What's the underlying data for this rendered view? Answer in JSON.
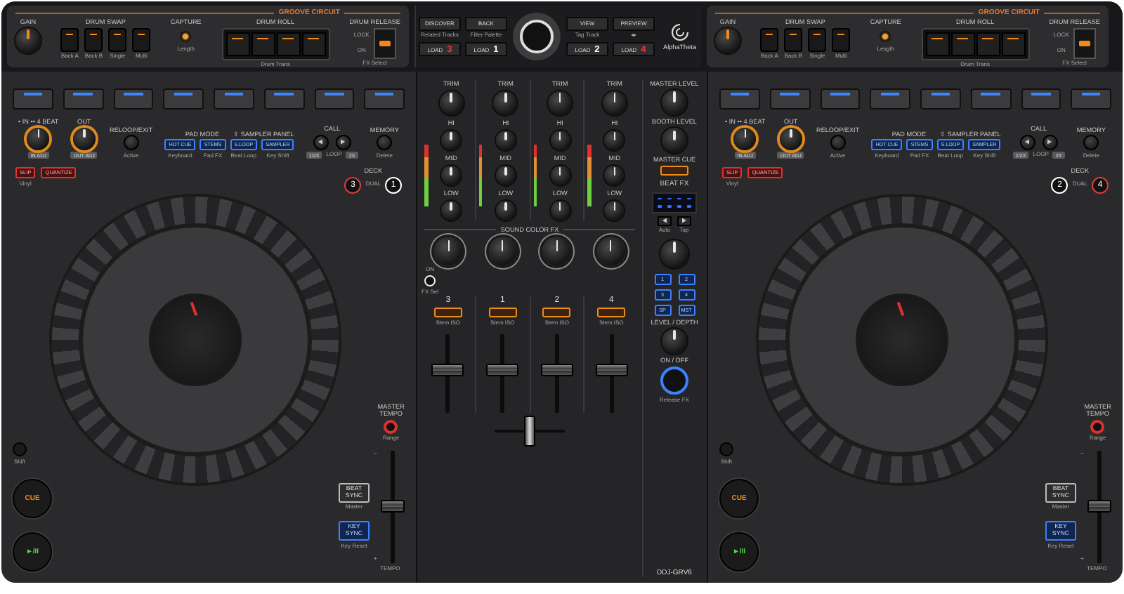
{
  "groove_circuits": [
    {
      "title": "GROOVE CIRCUIT",
      "gain": "GAIN",
      "drum_swap": {
        "label": "DRUM SWAP",
        "buttons": [
          "Back A",
          "Back B",
          "Single",
          "Multi"
        ]
      },
      "capture": {
        "label": "CAPTURE",
        "sub": "Length"
      },
      "drum_roll": {
        "label": "DRUM ROLL",
        "sub": "Drum Trans"
      },
      "drum_release": {
        "label": "DRUM RELEASE",
        "lock": "LOCK",
        "on": "ON",
        "sub": "FX Select"
      }
    },
    {
      "title": "GROOVE CIRCUIT",
      "gain": "GAIN",
      "drum_swap": {
        "label": "DRUM SWAP",
        "buttons": [
          "Back A",
          "Back B",
          "Single",
          "Multi"
        ]
      },
      "capture": {
        "label": "CAPTURE",
        "sub": "Length"
      },
      "drum_roll": {
        "label": "DRUM ROLL",
        "sub": "Drum Trans"
      },
      "drum_release": {
        "label": "DRUM RELEASE",
        "lock": "LOCK",
        "on": "ON",
        "sub": "FX Select"
      }
    }
  ],
  "browser": {
    "left": [
      {
        "label": "DISCOVER",
        "sub": "Related Tracks"
      },
      {
        "label": "BACK",
        "sub": "Filter Palette"
      }
    ],
    "right": [
      {
        "label": "VIEW",
        "sub": "Tag Track"
      },
      {
        "label": "PREVIEW",
        "sub": "◂▸"
      }
    ],
    "loads_left": [
      {
        "label": "LOAD",
        "deck": "3",
        "color": "#e03a3a"
      },
      {
        "label": "LOAD",
        "deck": "1",
        "color": "#ffffff"
      }
    ],
    "loads_right": [
      {
        "label": "LOAD",
        "deck": "2",
        "color": "#ffffff"
      },
      {
        "label": "LOAD",
        "deck": "4",
        "color": "#e03a3a"
      }
    ],
    "logo": "AlphaTheta"
  },
  "decks": [
    {
      "loop_in": {
        "label": "• IN  •• 4 BEAT",
        "sub": "IN ADJ"
      },
      "loop_out": {
        "label": "OUT",
        "sub": "OUT ADJ"
      },
      "reloop": {
        "label": "RELOOP/EXIT",
        "sub": "Active"
      },
      "pad_mode": {
        "label": "PAD MODE",
        "shift_label": "⇧ SAMPLER PANEL",
        "modes": [
          {
            "label": "HOT CUE",
            "sub": "Keyboard"
          },
          {
            "label": "STEMS",
            "sub": "Pad FX"
          },
          {
            "label": "S.LOOP",
            "sub": "Beat Loop"
          },
          {
            "label": "SAMPLER",
            "sub": "Key Shift"
          }
        ]
      },
      "call": {
        "label": "CALL",
        "loop": "LOOP",
        "left": "1/2X",
        "right": "2X"
      },
      "memory": {
        "label": "MEMORY",
        "sub": "Delete"
      },
      "slip": {
        "label": "SLIP",
        "sub": "Vinyl"
      },
      "quantize": "QUANTIZE",
      "deck_select": {
        "label": "DECK",
        "dual": "DUAL",
        "decks": [
          {
            "number": "3",
            "color": "#e03a3a"
          },
          {
            "number": "1",
            "color": "#ffffff"
          }
        ]
      },
      "shift": "Shift",
      "cue": "CUE",
      "play": "►/II",
      "master_tempo": {
        "label": "MASTER TEMPO",
        "sub": "Range"
      },
      "beat_sync": {
        "label": "BEAT SYNC",
        "sub": "Master"
      },
      "key_sync": {
        "label": "KEY SYNC",
        "sub": "Key Reset"
      },
      "tempo": {
        "label": "TEMPO",
        "minus": "−",
        "plus": "+",
        "level": 0.5
      }
    },
    {
      "loop_in": {
        "label": "• IN  •• 4 BEAT",
        "sub": "IN ADJ"
      },
      "loop_out": {
        "label": "OUT",
        "sub": "OUT ADJ"
      },
      "reloop": {
        "label": "RELOOP/EXIT",
        "sub": "Active"
      },
      "pad_mode": {
        "label": "PAD MODE",
        "shift_label": "⇧ SAMPLER PANEL",
        "modes": [
          {
            "label": "HOT CUE",
            "sub": "Keyboard"
          },
          {
            "label": "STEMS",
            "sub": "Pad FX"
          },
          {
            "label": "S.LOOP",
            "sub": "Beat Loop"
          },
          {
            "label": "SAMPLER",
            "sub": "Key Shift"
          }
        ]
      },
      "call": {
        "label": "CALL",
        "loop": "LOOP",
        "left": "1/2X",
        "right": "2X"
      },
      "memory": {
        "label": "MEMORY",
        "sub": "Delete"
      },
      "slip": {
        "label": "SLIP",
        "sub": "Vinyl"
      },
      "quantize": "QUANTIZE",
      "deck_select": {
        "label": "DECK",
        "dual": "DUAL",
        "decks": [
          {
            "number": "2",
            "color": "#ffffff"
          },
          {
            "number": "4",
            "color": "#e03a3a"
          }
        ]
      },
      "shift": "Shift",
      "cue": "CUE",
      "play": "►/II",
      "master_tempo": {
        "label": "MASTER TEMPO",
        "sub": "Range"
      },
      "beat_sync": {
        "label": "BEAT SYNC",
        "sub": "Master"
      },
      "key_sync": {
        "label": "KEY SYNC",
        "sub": "Key Reset"
      },
      "tempo": {
        "label": "TEMPO",
        "minus": "−",
        "plus": "+",
        "level": 0.5
      }
    }
  ],
  "mixer": {
    "channels": [
      {
        "number": "3",
        "trim": "TRIM",
        "hi": "HI",
        "mid": "MID",
        "low": "LOW",
        "cue": "Stem ISO",
        "level": 0.55
      },
      {
        "number": "1",
        "trim": "TRIM",
        "hi": "HI",
        "mid": "MID",
        "low": "LOW",
        "cue": "Stem ISO",
        "level": 0.55
      },
      {
        "number": "2",
        "trim": "TRIM",
        "hi": "HI",
        "mid": "MID",
        "low": "LOW",
        "cue": "Stem ISO",
        "level": 0.55
      },
      {
        "number": "4",
        "trim": "TRIM",
        "hi": "HI",
        "mid": "MID",
        "low": "LOW",
        "cue": "Stem ISO",
        "level": 0.55
      }
    ],
    "sound_color_fx": {
      "label": "SOUND COLOR FX",
      "on": "ON",
      "sub": "FX Sel"
    },
    "crossfader": {
      "level": 0.5
    },
    "master_level": "MASTER LEVEL",
    "booth_level": "BOOTH LEVEL",
    "master_cue": "MASTER CUE",
    "beat_fx": {
      "label": "BEAT FX",
      "prev_sub": "Auto",
      "next_sub": "Tap",
      "channel_buttons": [
        "1",
        "2",
        "3",
        "4",
        "SP",
        "MST"
      ],
      "level_depth": "LEVEL / DEPTH",
      "on_off": "ON / OFF",
      "release": "Release FX"
    },
    "model": "DDJ-GRV6"
  }
}
